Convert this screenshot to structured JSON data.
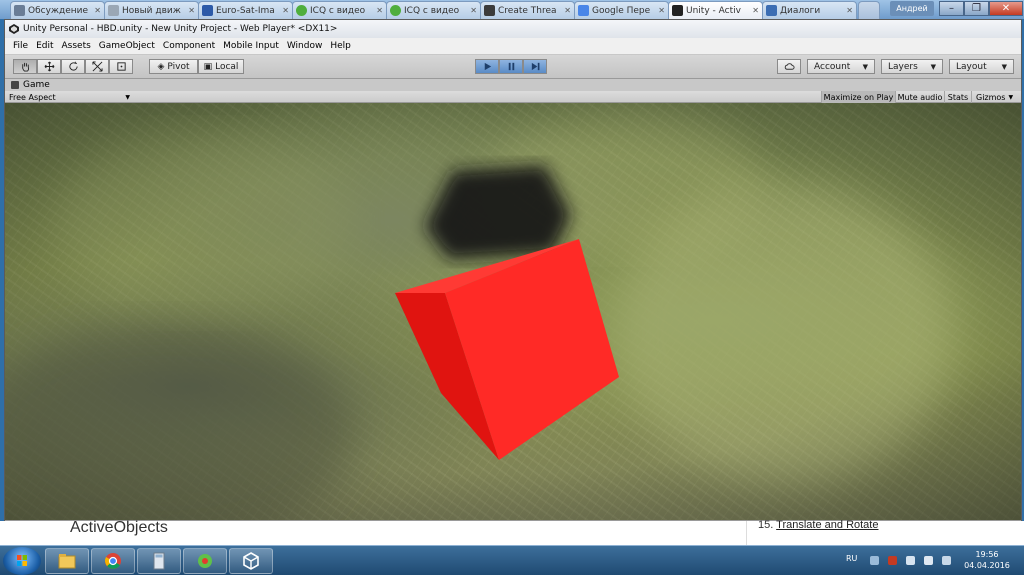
{
  "browser": {
    "tabs": [
      {
        "label": "Обсуждение",
        "color": "#6a7d96"
      },
      {
        "label": "Новый движ",
        "color": "#9aa7b5"
      },
      {
        "label": "Euro-Sat-Ima",
        "color": "#2d5aa8"
      },
      {
        "label": "ICQ с видео",
        "color": "#4fae3c"
      },
      {
        "label": "ICQ с видео",
        "color": "#4fae3c"
      },
      {
        "label": "Create Threa",
        "color": "#3b3b3b"
      },
      {
        "label": "Google Пере",
        "color": "#4a86e8"
      },
      {
        "label": "Unity - Activ",
        "color": "#222222"
      },
      {
        "label": "Диалоги",
        "color": "#3b6db3"
      }
    ],
    "active_tab": 7,
    "user": "Андрей"
  },
  "unity": {
    "title": "Unity Personal - HBD.unity - New Unity Project - Web Player* <DX11>",
    "menu": [
      "File",
      "Edit",
      "Assets",
      "GameObject",
      "Component",
      "Mobile Input",
      "Window",
      "Help"
    ],
    "toolbar": {
      "pivot": "Pivot",
      "local": "Local",
      "account": "Account",
      "layers": "Layers",
      "layout": "Layout"
    },
    "game": {
      "tab_label": "Game",
      "aspect": "Free Aspect",
      "maximize": "Maximize on Play",
      "mute": "Mute audio",
      "stats": "Stats",
      "gizmos": "Gizmos"
    },
    "colors": {
      "cube": "#ff2a26",
      "cube_side": "#e01410",
      "shadow": "#141414",
      "play_active": "#5a8bc6"
    }
  },
  "behind_page": {
    "left_text": "ActiveObjects",
    "right_number": "15.",
    "right_link": "Translate and Rotate"
  },
  "taskbar": {
    "lang": "RU",
    "time": "19:56",
    "date": "04.04.2016"
  }
}
